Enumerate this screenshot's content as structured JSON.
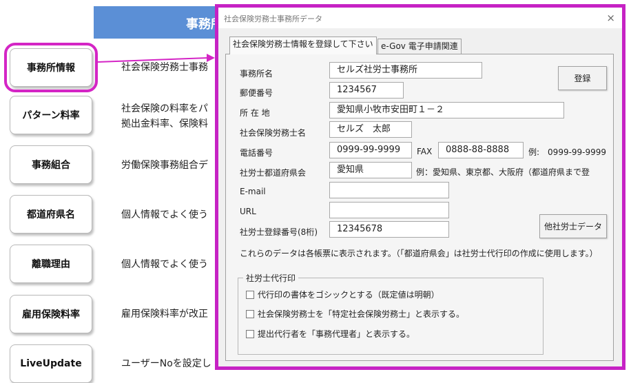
{
  "header": {
    "title": "事務所"
  },
  "sidebar": {
    "items": [
      {
        "label": "事務所情報",
        "desc": "社会保険労務士事務"
      },
      {
        "label": "パターン料率",
        "desc": "社会保険の料率をパ",
        "desc2": "拠出金料率、保険料"
      },
      {
        "label": "事務組合",
        "desc": "労働保険事務組合デ"
      },
      {
        "label": "都道府県名",
        "desc": "個人情報でよく使う"
      },
      {
        "label": "離職理由",
        "desc": "個人情報でよく使う"
      },
      {
        "label": "雇用保険料率",
        "desc": "雇用保険料率が改正"
      },
      {
        "label": "LiveUpdate",
        "desc": "ユーザーNoを設定し"
      }
    ]
  },
  "dialog": {
    "title": "社会保険労務士事務所データ",
    "close": "×",
    "tabs": [
      {
        "label": "社会保険労務士情報を登録して下さい"
      },
      {
        "label": "e-Gov 電子申請関連"
      }
    ],
    "fields": {
      "office_name": {
        "label": "事務所名",
        "value": "セルズ社労士事務所"
      },
      "postal": {
        "label": "郵便番号",
        "value": "1234567"
      },
      "address": {
        "label": "所 在 地",
        "value": "愛知県小牧市安田町１－２"
      },
      "name": {
        "label": "社会保険労務士名",
        "value": "セルズ　太郎"
      },
      "phone": {
        "label": "電話番号",
        "value": "0999-99-9999"
      },
      "fax": {
        "label": "FAX",
        "value": "0888-88-8888"
      },
      "phone_example": "例:　0999-99-9999",
      "prefecture": {
        "label": "社労士都道府県会",
        "value": "愛知県"
      },
      "prefecture_example": "例：愛知県、東京都、大阪府（都道府県まで登",
      "email": {
        "label": "E-mail",
        "value": ""
      },
      "url": {
        "label": "URL",
        "value": ""
      },
      "reg_no": {
        "label": "社労士登録番号(8桁)",
        "value": "12345678"
      }
    },
    "buttons": {
      "register": "登録",
      "other": "他社労士データ"
    },
    "note": "これらのデータは各帳票に表示されます。（「都道府県会」は社労士代行印の作成に使用します。）",
    "group": {
      "title": "社労士代行印",
      "options": [
        "代行印の書体をゴシックとする（既定値は明朝）",
        "社会保険労務士を「特定社会保険労務士」と表示する。",
        "提出代行者を「事務代理者」と表示する。"
      ]
    }
  }
}
